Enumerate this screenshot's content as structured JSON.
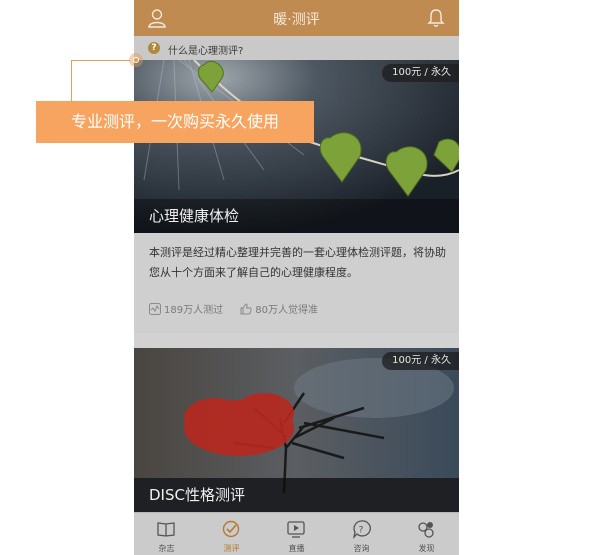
{
  "header": {
    "title": "暖·测评"
  },
  "notice": {
    "text": "什么是心理测评?"
  },
  "cards": [
    {
      "price": "100元 / 永久",
      "title": "心理健康体检",
      "description": "本测评是经过精心整理并完善的一套心理体检测评题，将协助您从十个方面来了解自己的心理健康程度。",
      "tested": "189万人测过",
      "liked": "80万人觉得准"
    },
    {
      "price": "100元 / 永久",
      "title": "DISC性格测评"
    }
  ],
  "tabs": [
    {
      "label": "杂志",
      "icon": "book-icon"
    },
    {
      "label": "测评",
      "icon": "quiz-icon"
    },
    {
      "label": "直播",
      "icon": "play-icon"
    },
    {
      "label": "咨询",
      "icon": "question-bubble-icon"
    },
    {
      "label": "发现",
      "icon": "discover-icon"
    }
  ],
  "callout": {
    "text": "专业测评，一次购买永久使用"
  },
  "colors": {
    "header": "#c08b50",
    "accent": "#f6a45f",
    "active_tab": "#b7782f"
  }
}
